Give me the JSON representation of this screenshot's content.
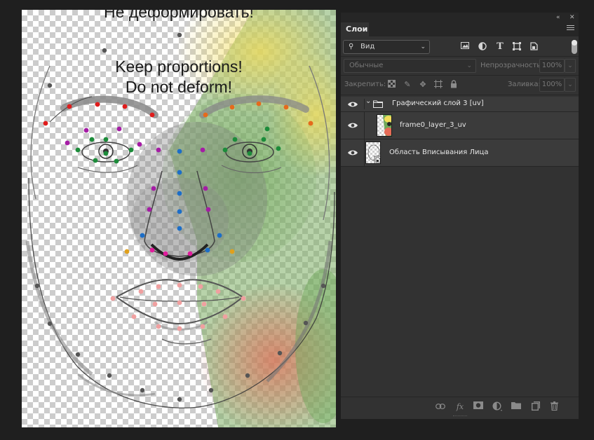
{
  "canvas": {
    "heading_partial": "Не деформировать!",
    "line1": "Keep proportions!",
    "line2": "Do not deform!"
  },
  "panel": {
    "collapse_icon": "double-chevron-icon",
    "close_icon": "close-icon",
    "tab_label": "Слои",
    "menu_icon": "hamburger-menu-icon",
    "filter": {
      "search_icon": "search-icon",
      "label": "Вид",
      "icons": [
        "image-filter-icon",
        "adjustment-filter-icon",
        "type-filter-icon",
        "shape-filter-icon",
        "smart-object-filter-icon"
      ]
    },
    "blend_mode": "Обычные",
    "opacity_label": "Непрозрачность:",
    "opacity_value": "100%",
    "lock_label": "Закрепить:",
    "fill_label": "Заливка:",
    "fill_value": "100%",
    "layers": [
      {
        "name": "Графический слой 3 [uv]",
        "type": "group",
        "expanded": true
      },
      {
        "name": "frame0_layer_3_uv",
        "type": "layer"
      },
      {
        "name": "Область Вписывания Лица",
        "type": "smart-object"
      }
    ],
    "bottom_icons": [
      "link-icon",
      "fx-icon",
      "mask-icon",
      "adjustment-layer-icon",
      "folder-icon",
      "new-layer-icon",
      "trash-icon"
    ],
    "fx_label": "fx"
  },
  "colors": {
    "panel_bg": "#323232",
    "selected_row": "#3b3b3b",
    "app_bg": "#1f1f1f"
  }
}
